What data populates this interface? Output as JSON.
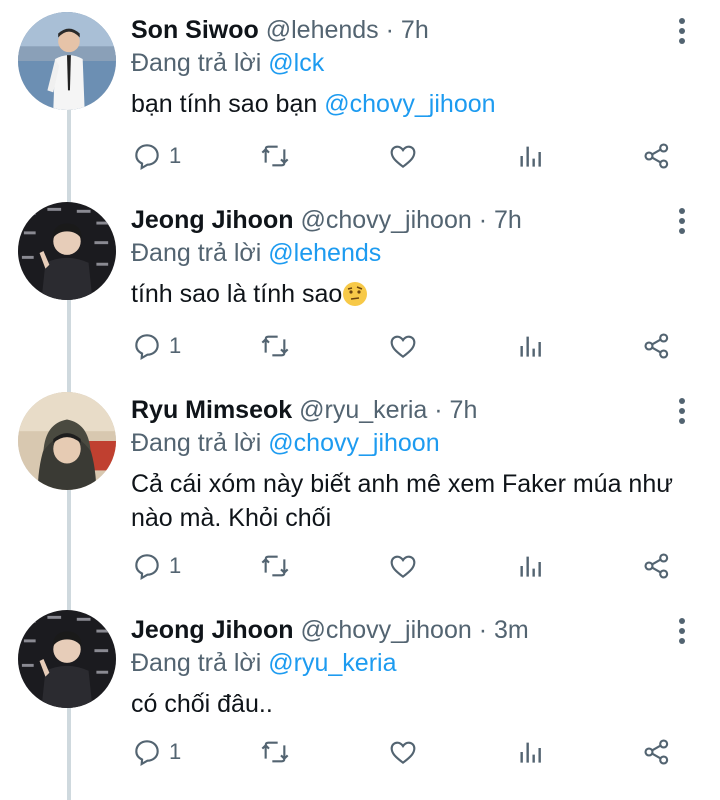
{
  "tweets": [
    {
      "name": "Son Siwoo",
      "handle": "@lehends",
      "time": "· 7h",
      "replying_label": "Đang trả lời",
      "replying_to": "@lck",
      "text": "bạn tính sao bạn ",
      "text_mention": "@chovy_jihoon",
      "reply_count": "1"
    },
    {
      "name": "Jeong Jihoon",
      "handle": "@chovy_jihoon",
      "time": "· 7h",
      "replying_label": "Đang trả lời",
      "replying_to": "@lehends",
      "text": "tính sao là tính sao",
      "text_emoji": "raised-eyebrow-emoji",
      "reply_count": "1"
    },
    {
      "name": "Ryu Mimseok",
      "handle": "@ryu_keria",
      "time": "· 7h",
      "replying_label": "Đang trả lời",
      "replying_to": "@chovy_jihoon",
      "text": "Cả cái xóm này biết anh mê xem Faker múa như nào mà. Khỏi chối",
      "reply_count": "1"
    },
    {
      "name": "Jeong Jihoon",
      "handle": "@chovy_jihoon",
      "time": "· 3m",
      "replying_label": "Đang trả lời",
      "replying_to": "@ryu_keria",
      "text": "có chối đâu..",
      "reply_count": "1"
    }
  ],
  "colors": {
    "link": "#1d9bf0",
    "secondary": "#536471",
    "thread_line": "#cfd9de"
  },
  "icons": [
    "reply-icon",
    "retweet-icon",
    "like-icon",
    "analytics-icon",
    "share-icon",
    "more-icon"
  ]
}
